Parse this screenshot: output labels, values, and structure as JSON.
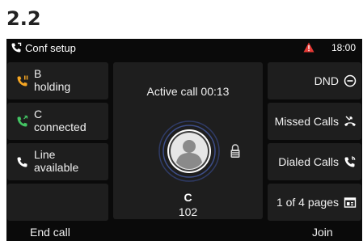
{
  "heading": "2.2",
  "status_bar": {
    "title": "Conf setup",
    "time": "18:00",
    "warning_color": "#e53935"
  },
  "lines": [
    {
      "line1": "B",
      "line2": "holding",
      "icon": "phone-hold-icon",
      "color": "#f5a623"
    },
    {
      "line1": "C",
      "line2": "connected",
      "icon": "phone-connected-icon",
      "color": "#43c463"
    },
    {
      "line1": "Line",
      "line2": "available",
      "icon": "phone-icon",
      "color": "#ffffff"
    },
    {
      "line1": "",
      "line2": "",
      "icon": "",
      "color": ""
    }
  ],
  "active_call": {
    "label": "Active call 00:13",
    "name": "C",
    "number": "102"
  },
  "right_keys": [
    {
      "label": "DND",
      "icon": "dnd-icon"
    },
    {
      "label": "Missed Calls",
      "icon": "missed-calls-icon"
    },
    {
      "label": "Dialed Calls",
      "icon": "dialed-calls-icon"
    },
    {
      "label": "1 of 4 pages",
      "icon": "pages-icon"
    }
  ],
  "softkeys": {
    "left": "End call",
    "right": "Join"
  }
}
